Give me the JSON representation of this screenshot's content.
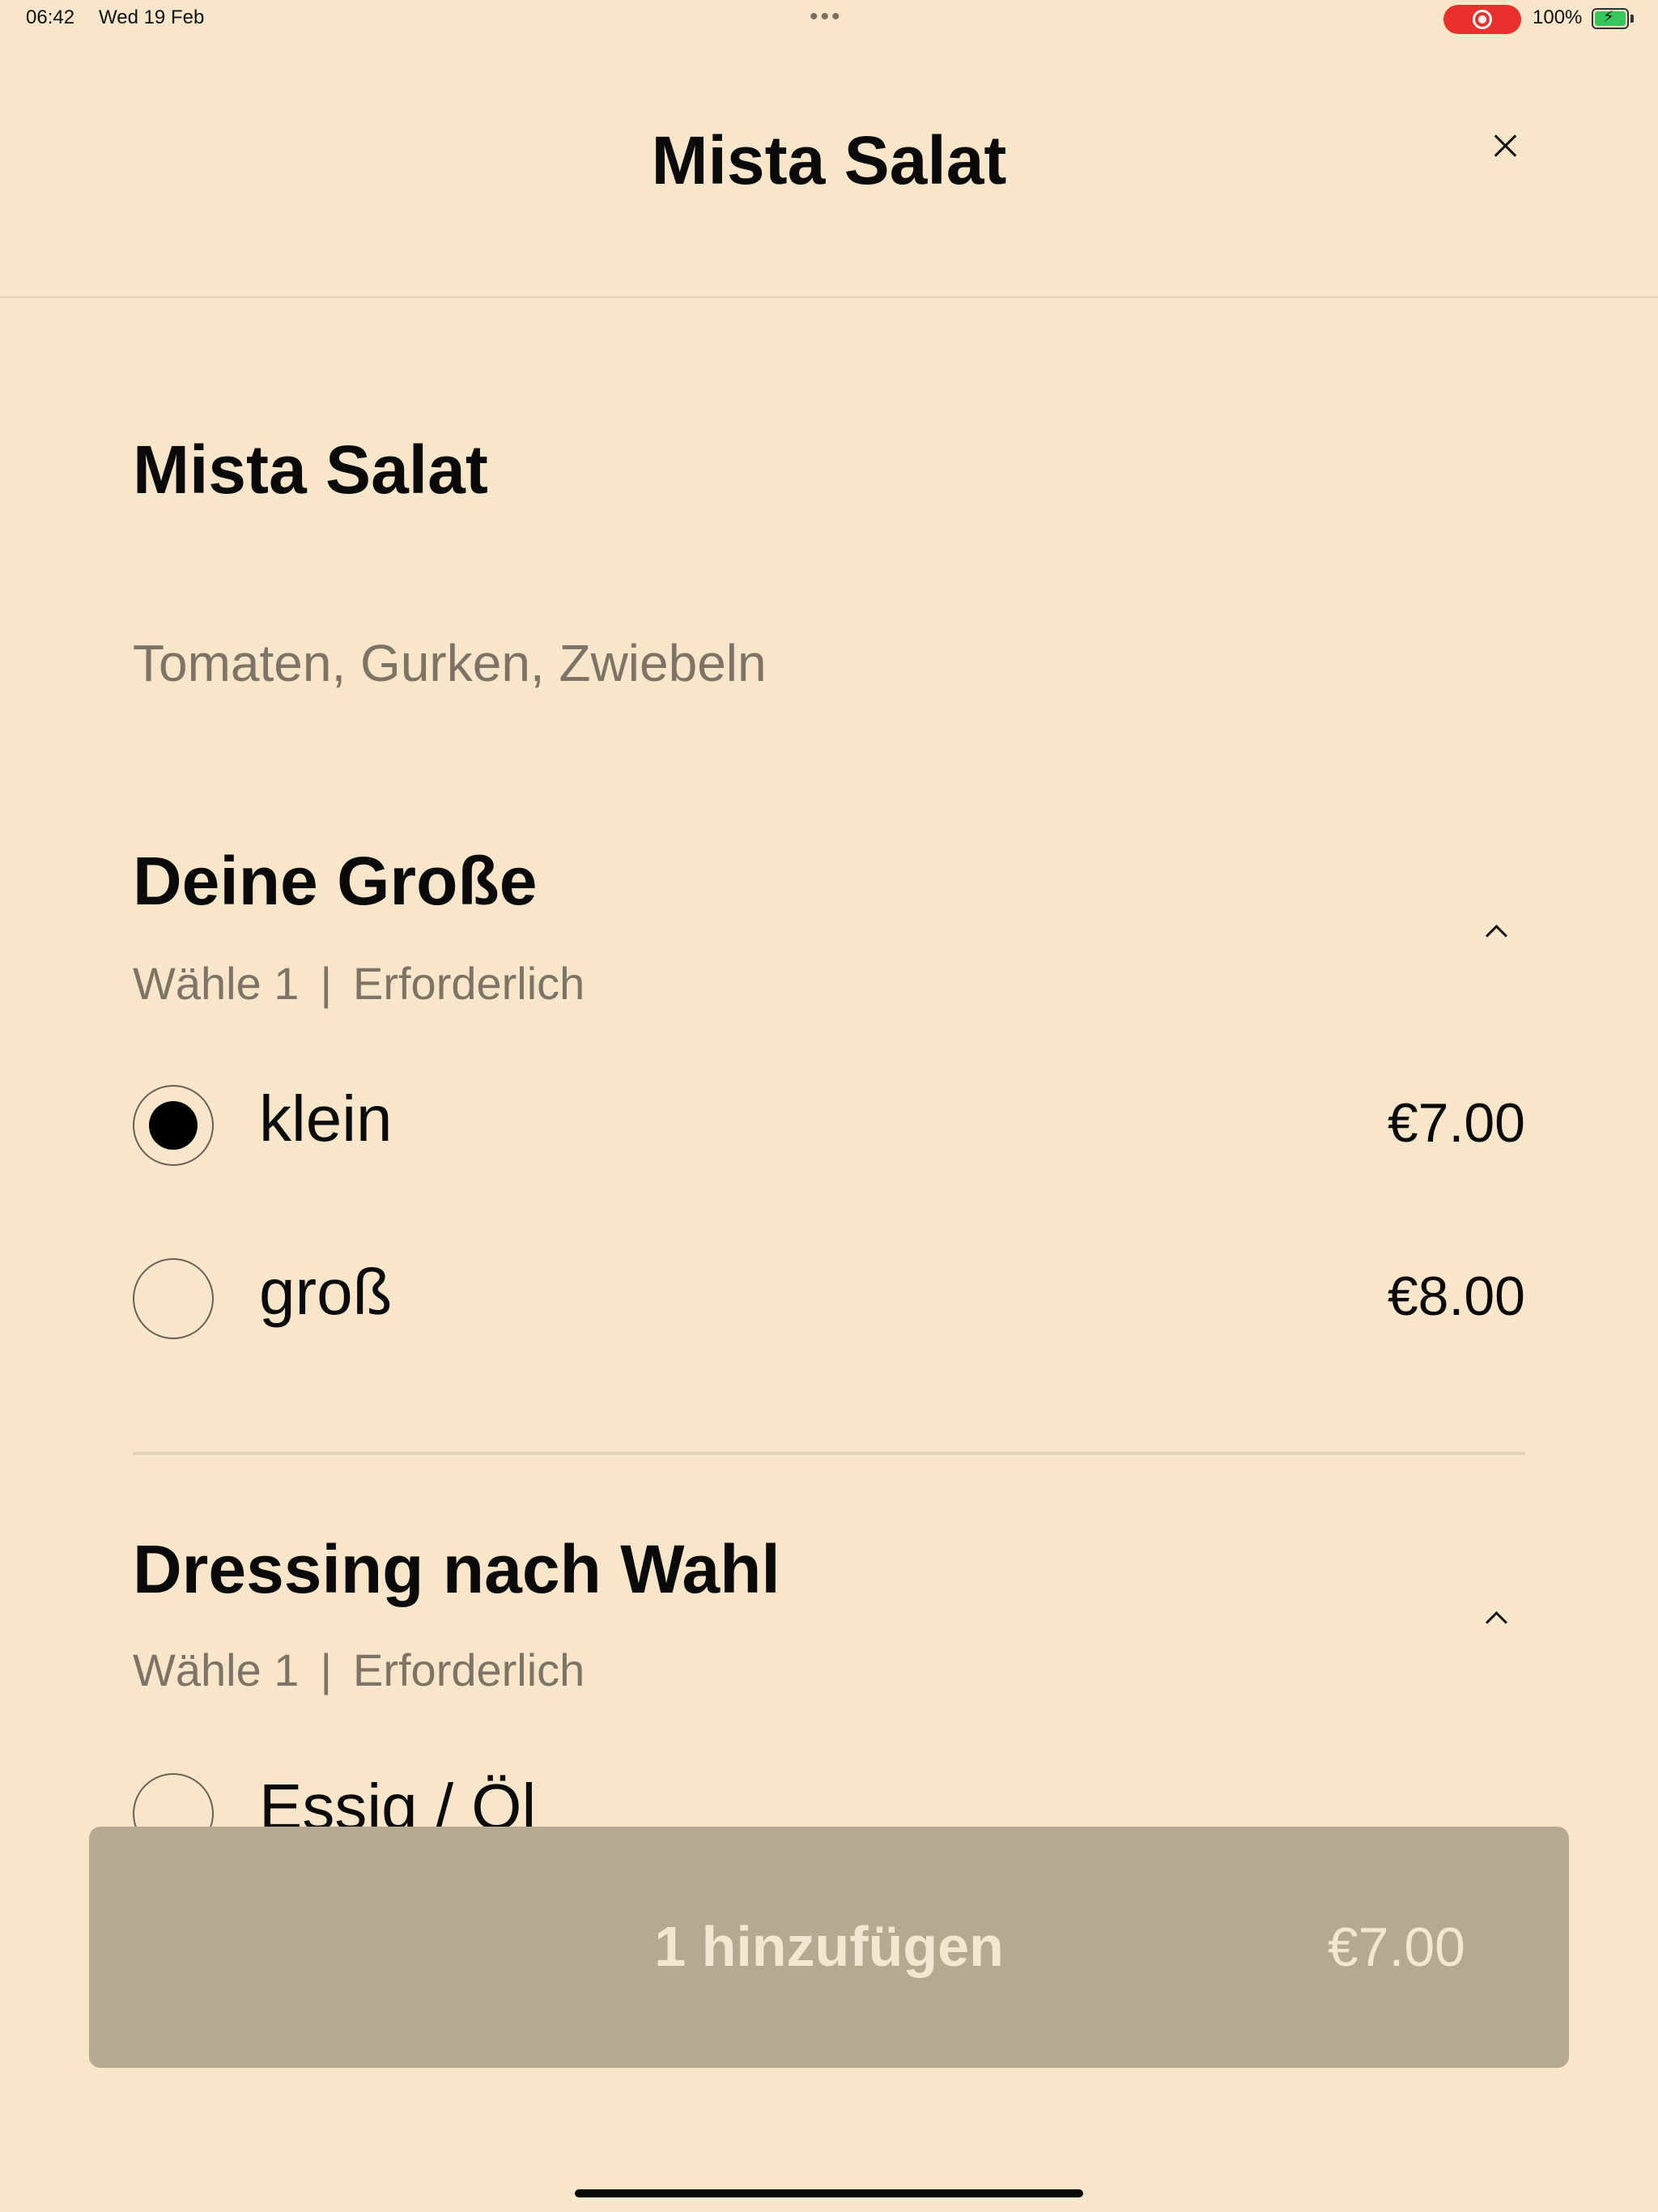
{
  "status_bar": {
    "time": "06:42",
    "date": "Wed 19 Feb",
    "dots": "•••",
    "battery_percent": "100%",
    "battery_level": 1.0,
    "recording_color": "#e8312c"
  },
  "header": {
    "title": "Mista Salat",
    "close_icon": "close-icon"
  },
  "item": {
    "title": "Mista Salat",
    "description": "Tomaten, Gurken, Zwiebeln"
  },
  "groups": [
    {
      "title": "Deine Große",
      "choose": "Wähle 1",
      "separator": "|",
      "required": "Erforderlich",
      "options": [
        {
          "label": "klein",
          "price": "€7.00",
          "selected": true
        },
        {
          "label": "groß",
          "price": "€8.00",
          "selected": false
        }
      ]
    },
    {
      "title": "Dressing nach Wahl",
      "choose": "Wähle 1",
      "separator": "|",
      "required": "Erforderlich",
      "options": [
        {
          "label": "Essig / Öl",
          "price": "",
          "selected": false
        }
      ]
    }
  ],
  "add_button": {
    "label": "1 hinzufügen",
    "price": "€7.00",
    "background": "#b6a991"
  },
  "colors": {
    "background": "#f7e6c9",
    "muted_text": "#7d7466"
  }
}
